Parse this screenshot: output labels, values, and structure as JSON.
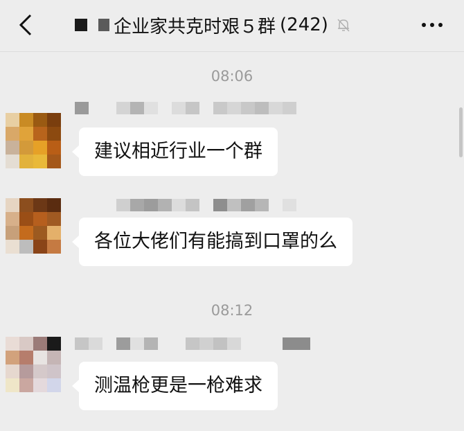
{
  "header": {
    "title": "企业家共克时艰５群",
    "count": "(242)",
    "back_icon": "chevron-left-icon",
    "mute_icon": "bell-off-icon",
    "more_icon": "ellipsis-icon"
  },
  "messages": [
    {
      "time": "08:06",
      "text": "建议相近行业一个群"
    },
    {
      "text": "各位大佬们有能搞到口罩的么"
    },
    {
      "time": "08:12",
      "text": "测温枪更是一枪难求"
    }
  ]
}
